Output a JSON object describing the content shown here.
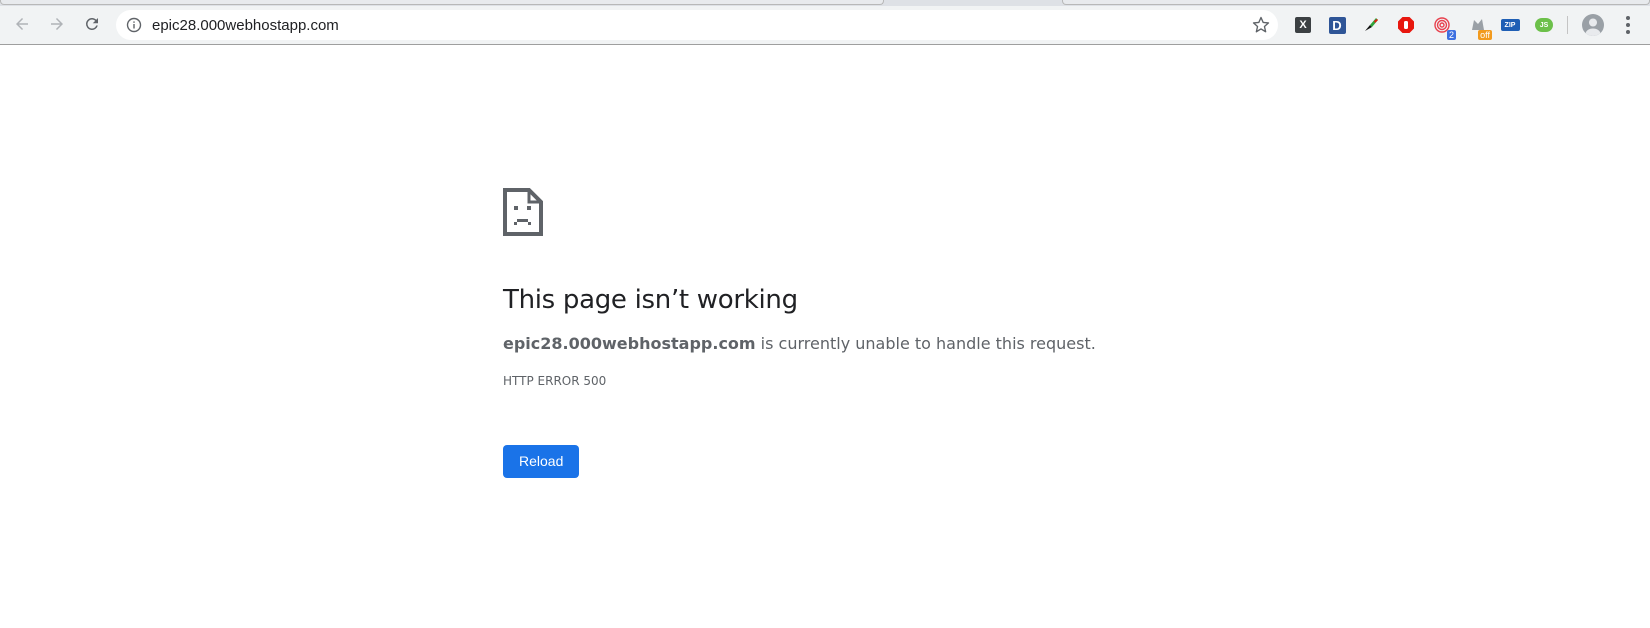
{
  "browser": {
    "url": "epic28.000webhostapp.com",
    "extensions": [
      {
        "name": "x-extension",
        "glyph": "X",
        "bg": "#3c4043"
      },
      {
        "name": "d-extension",
        "glyph": "D",
        "bg": "#2f5597"
      },
      {
        "name": "brush-extension",
        "glyph": "",
        "bg": ""
      },
      {
        "name": "stop-extension",
        "glyph": "",
        "bg": "#e8170e"
      },
      {
        "name": "fingerprint-extension",
        "glyph": "",
        "bg": "",
        "badge": "2",
        "badge_color": "#3d6fe0"
      },
      {
        "name": "cookie-extension",
        "glyph": "",
        "bg": "",
        "badge": "off",
        "badge_color": "#f29a1e"
      },
      {
        "name": "zip-extension",
        "glyph": "ZIP",
        "bg": "#1f5fb5"
      },
      {
        "name": "js-extension",
        "glyph": "JS",
        "bg": "#6cc04a"
      }
    ]
  },
  "error_page": {
    "heading": "This page isn’t working",
    "host": "epic28.000webhostapp.com",
    "message": " is currently unable to handle this request.",
    "error_code": "HTTP ERROR 500",
    "reload_label": "Reload"
  },
  "colors": {
    "accent": "#1a73e8",
    "text_primary": "#202124",
    "text_secondary": "#5f6368"
  }
}
